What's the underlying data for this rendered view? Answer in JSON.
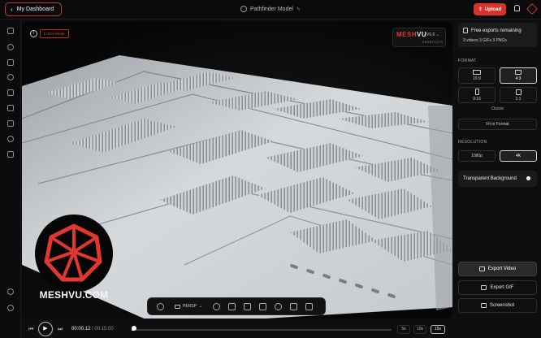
{
  "header": {
    "dashboard_label": "My Dashboard",
    "title": "Pathfinder Model",
    "upload_label": "Upload"
  },
  "viewport": {
    "dev_badge": "In Dev Mode",
    "info_glyph": "i",
    "logo": {
      "mesh": "MESH",
      "vu": "VU",
      "version": "V6.6",
      "sub": "SHORTCUTS"
    },
    "watermark": "MESHVU.COM",
    "toolbar": {
      "projection": "PERSP"
    }
  },
  "playback": {
    "current": "00:00.12",
    "total": "/ 00:15.00",
    "progress": 0.008,
    "speeds": [
      "5x",
      "10s",
      "15s"
    ],
    "selected_speed": "15s"
  },
  "panel": {
    "exports_title": "Free exports remaining",
    "exports_detail": "3 videos   3 GIFs   3 PNGs",
    "format_label": "FORMAT",
    "formats": [
      "16:9",
      "4:3",
      "9:16",
      "1:1"
    ],
    "selected_format": "4:3",
    "format_style": "Classic",
    "fit_label": "Fit to Format",
    "resolution_label": "RESOLUTION",
    "resolutions": [
      "1080p",
      "4K"
    ],
    "selected_resolution": "4K",
    "transparent_label": "Transparent Background",
    "export_video": "Export Video",
    "export_gif": "Export GIF",
    "screenshot": "Screenshot"
  },
  "colors": {
    "accent": "#d8322a",
    "background": "#0e0e10"
  }
}
